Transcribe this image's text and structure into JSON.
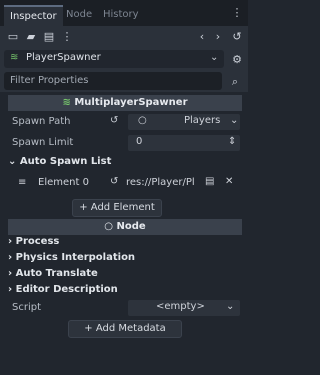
{
  "tabs": {
    "inspector": "Inspector",
    "node": "Node",
    "history": "History"
  },
  "object": {
    "name": "PlayerSpawner"
  },
  "filter": {
    "placeholder": "Filter Properties"
  },
  "multiplayer": {
    "title": "MultiplayerSpawner",
    "spawn_path_label": "Spawn Path",
    "spawn_path_value": "Players",
    "spawn_limit_label": "Spawn Limit",
    "spawn_limit_value": "0",
    "auto_spawn_label": "Auto Spawn List",
    "element_label": "Element 0",
    "element_value": "res://Player/Pl",
    "add_element_label": "Add Element"
  },
  "node": {
    "title": "Node",
    "groups": [
      "Process",
      "Physics Interpolation",
      "Auto Translate",
      "Editor Description"
    ],
    "script_label": "Script",
    "script_value": "<empty>",
    "add_metadata_label": "Add Metadata"
  }
}
